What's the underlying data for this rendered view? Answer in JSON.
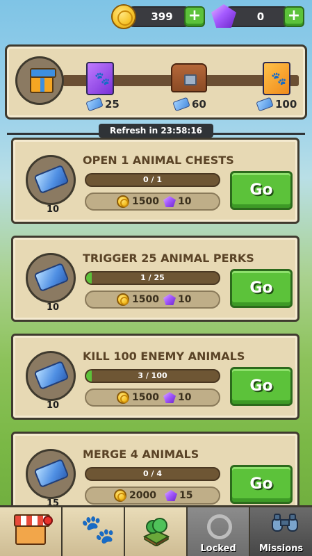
{
  "currency": {
    "coins": "399",
    "gems": "0",
    "add_coins_label": "+",
    "add_gems_label": "+"
  },
  "progress": {
    "tiers": [
      {
        "icon": "purple-paw-card-icon",
        "value": "25"
      },
      {
        "icon": "treasure-chest-icon",
        "value": "60"
      },
      {
        "icon": "orange-paw-card-icon",
        "value": "100"
      }
    ]
  },
  "refresh_text": "Refresh in 23:58:16",
  "missions": [
    {
      "title": "OPEN 1 ANIMAL CHESTS",
      "progress_text": "0 / 1",
      "progress": 0.0,
      "coins": "1500",
      "gems": "10",
      "tickets": "10",
      "go": "Go"
    },
    {
      "title": "TRIGGER 25 ANIMAL PERKS",
      "progress_text": "1 / 25",
      "progress": 0.04,
      "coins": "1500",
      "gems": "10",
      "tickets": "10",
      "go": "Go"
    },
    {
      "title": "KILL 100 ENEMY ANIMALS",
      "progress_text": "3 / 100",
      "progress": 0.03,
      "coins": "1500",
      "gems": "10",
      "tickets": "10",
      "go": "Go"
    },
    {
      "title": "MERGE 4 ANIMALS",
      "progress_text": "0 / 4",
      "progress": 0.0,
      "coins": "2000",
      "gems": "15",
      "tickets": "15",
      "go": "Go"
    }
  ],
  "nav": {
    "locked_label": "Locked",
    "missions_label": "Missions"
  },
  "colors": {
    "go_green": "#5cc23a",
    "panel": "#e7d9b4",
    "border": "#3f3a2e"
  }
}
